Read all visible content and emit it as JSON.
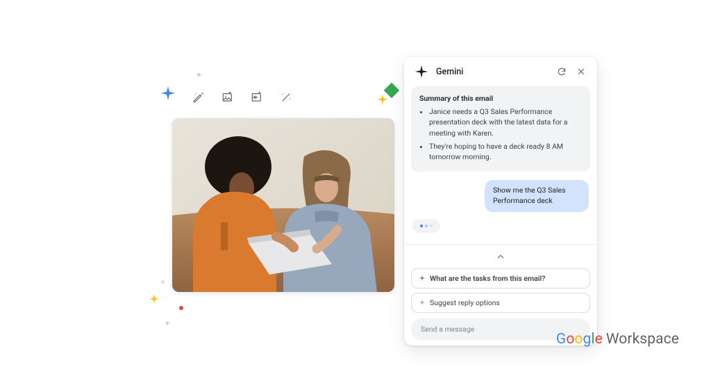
{
  "panel": {
    "title": "Gemini",
    "summary": {
      "heading": "Summary of this email",
      "points": [
        "Janice needs a Q3 Sales Performance presentation deck with the latest data for a meeting with Karen.",
        "They're hoping to have a deck ready 8 AM tomorrow morning."
      ]
    },
    "user_message": "Show me the Q3 Sales Performance deck",
    "suggestions": [
      "What are the tasks from this email?",
      "Suggest reply options"
    ],
    "input_placeholder": "Send a message"
  },
  "brand": {
    "google": "Google",
    "workspace": "Workspace"
  },
  "icons": {
    "gemini": "gemini-spark-icon",
    "refresh": "refresh-icon",
    "close": "close-icon",
    "wand": "magic-pencil-icon",
    "image_add": "image-add-icon",
    "image_expand": "image-expand-icon",
    "wand2": "magic-wand-icon",
    "chevron_up": "chevron-up-icon"
  }
}
